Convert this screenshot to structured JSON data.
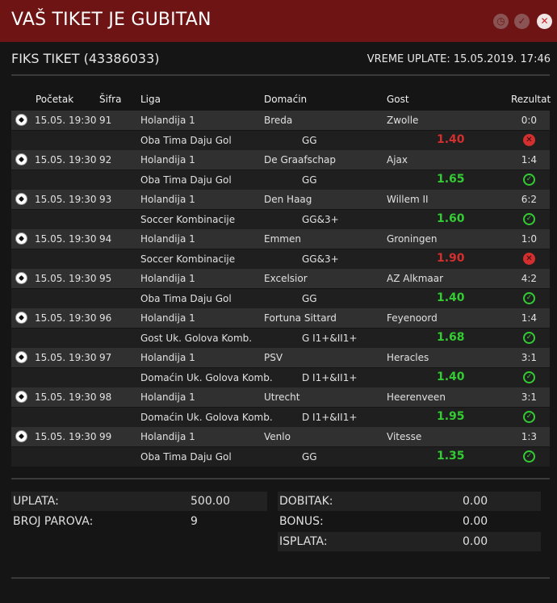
{
  "header": {
    "title": "VAŠ TIKET JE GUBITAN",
    "buttons": [
      {
        "name": "history-icon",
        "glyph": "◷"
      },
      {
        "name": "check-icon",
        "glyph": "✓"
      },
      {
        "name": "close-icon",
        "glyph": "✕"
      }
    ]
  },
  "ticket": {
    "name": "FIKS TIKET (43386033)",
    "payment_time": "VREME UPLATE: 15.05.2019. 17:46"
  },
  "columns": {
    "start": "Početak",
    "code": "Šifra",
    "league": "Liga",
    "home": "Domaćin",
    "away": "Gost",
    "result": "Rezultat"
  },
  "matches": [
    {
      "start": "15.05. 19:30",
      "code": "91",
      "league": "Holandija 1",
      "home": "Breda",
      "away": "Zwolle",
      "result": "0:0",
      "bet_type": "Oba Tima Daju Gol",
      "pick": "GG",
      "odd": "1.40",
      "status": "fail"
    },
    {
      "start": "15.05. 19:30",
      "code": "92",
      "league": "Holandija 1",
      "home": "De Graafschap",
      "away": "Ajax",
      "result": "1:4",
      "bet_type": "Oba Tima Daju Gol",
      "pick": "GG",
      "odd": "1.65",
      "status": "ok"
    },
    {
      "start": "15.05. 19:30",
      "code": "93",
      "league": "Holandija 1",
      "home": "Den Haag",
      "away": "Willem II",
      "result": "6:2",
      "bet_type": "Soccer Kombinacije",
      "pick": "GG&3+",
      "odd": "1.60",
      "status": "ok"
    },
    {
      "start": "15.05. 19:30",
      "code": "94",
      "league": "Holandija 1",
      "home": "Emmen",
      "away": "Groningen",
      "result": "1:0",
      "bet_type": "Soccer Kombinacije",
      "pick": "GG&3+",
      "odd": "1.90",
      "status": "fail"
    },
    {
      "start": "15.05. 19:30",
      "code": "95",
      "league": "Holandija 1",
      "home": "Excelsior",
      "away": "AZ Alkmaar",
      "result": "4:2",
      "bet_type": "Oba Tima Daju Gol",
      "pick": "GG",
      "odd": "1.40",
      "status": "ok"
    },
    {
      "start": "15.05. 19:30",
      "code": "96",
      "league": "Holandija 1",
      "home": "Fortuna Sittard",
      "away": "Feyenoord",
      "result": "1:4",
      "bet_type": "Gost Uk. Golova Komb.",
      "pick": "G I1+&II1+",
      "odd": "1.68",
      "status": "ok"
    },
    {
      "start": "15.05. 19:30",
      "code": "97",
      "league": "Holandija 1",
      "home": "PSV",
      "away": "Heracles",
      "result": "3:1",
      "bet_type": "Domaćin Uk. Golova Komb.",
      "pick": "D I1+&II1+",
      "odd": "1.40",
      "status": "ok"
    },
    {
      "start": "15.05. 19:30",
      "code": "98",
      "league": "Holandija 1",
      "home": "Utrecht",
      "away": "Heerenveen",
      "result": "3:1",
      "bet_type": "Domaćin Uk. Golova Komb.",
      "pick": "D I1+&II1+",
      "odd": "1.95",
      "status": "ok"
    },
    {
      "start": "15.05. 19:30",
      "code": "99",
      "league": "Holandija 1",
      "home": "Venlo",
      "away": "Vitesse",
      "result": "1:3",
      "bet_type": "Oba Tima Daju Gol",
      "pick": "GG",
      "odd": "1.35",
      "status": "ok"
    }
  ],
  "summary_left": [
    {
      "label": "UPLATA:",
      "value": "500.00"
    },
    {
      "label": "BROJ PAROVA:",
      "value": "9"
    }
  ],
  "summary_right": [
    {
      "label": "DOBITAK:",
      "value": "0.00"
    },
    {
      "label": "BONUS:",
      "value": "0.00"
    },
    {
      "label": "ISPLATA:",
      "value": "0.00"
    }
  ],
  "colors": {
    "header_bg": "#6e1414",
    "odd_ok": "#33cc33",
    "odd_fail": "#d32f2f",
    "row_top": "#303030",
    "row_bottom": "#1f1f1f"
  },
  "icons": {
    "sport": "soccer-ball-icon",
    "status_ok": "check-circle-icon",
    "status_fail": "x-circle-icon"
  }
}
